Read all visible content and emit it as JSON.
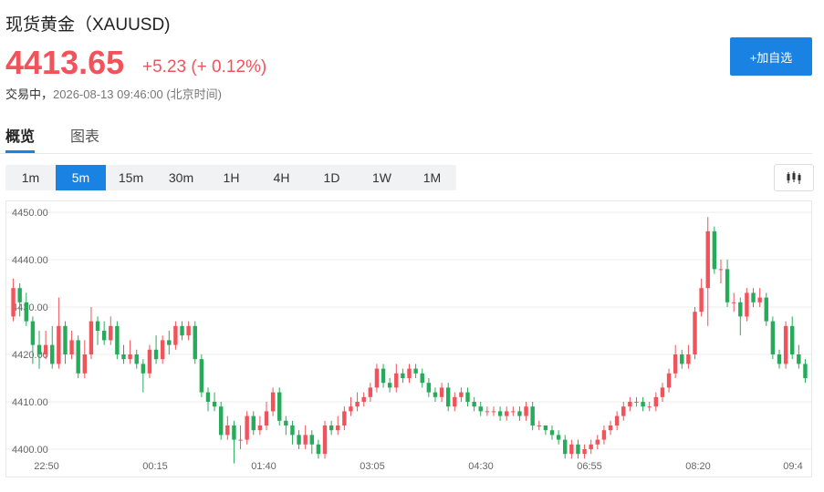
{
  "header": {
    "title": "现货黄金（XAUUSD)",
    "price": "4413.65",
    "change": "+5.23 (+ 0.12%)",
    "status_label": "交易中，",
    "timestamp": "2026-08-13 09:46:00 (北京时间)",
    "add_button": "+加自选"
  },
  "tabs": [
    {
      "label": "概览",
      "active": true
    },
    {
      "label": "图表",
      "active": false
    }
  ],
  "intervals": [
    {
      "label": "1m",
      "active": false
    },
    {
      "label": "5m",
      "active": true
    },
    {
      "label": "15m",
      "active": false
    },
    {
      "label": "30m",
      "active": false
    },
    {
      "label": "1H",
      "active": false
    },
    {
      "label": "4H",
      "active": false
    },
    {
      "label": "1D",
      "active": false
    },
    {
      "label": "1W",
      "active": false
    },
    {
      "label": "1M",
      "active": false
    }
  ],
  "chart_type_icon": "candlestick-icon",
  "colors": {
    "up": "#f0535a",
    "down": "#26ab5a",
    "accent": "#1a82e2"
  },
  "chart_data": {
    "type": "candlestick",
    "ylim": [
      4398,
      4452
    ],
    "yticks": [
      "4450.00",
      "4440.00",
      "4430.00",
      "4420.00",
      "4410.00",
      "4400.00"
    ],
    "xticks": [
      "22:50",
      "00:15",
      "01:40",
      "03:05",
      "04:30",
      "06:55",
      "08:20",
      "09:4"
    ],
    "grid": true,
    "candles": [
      [
        4428,
        4434,
        4436,
        4427
      ],
      [
        4434,
        4431,
        4435,
        4428
      ],
      [
        4431,
        4427,
        4433,
        4426
      ],
      [
        4427,
        4422,
        4428,
        4418
      ],
      [
        4422,
        4420,
        4425,
        4417
      ],
      [
        4420,
        4422,
        4425,
        4419
      ],
      [
        4422,
        4418,
        4426,
        4417
      ],
      [
        4418,
        4426,
        4432,
        4417
      ],
      [
        4426,
        4420,
        4427,
        4418
      ],
      [
        4420,
        4423,
        4425,
        4419
      ],
      [
        4423,
        4416,
        4424,
        4415
      ],
      [
        4416,
        4420,
        4423,
        4415
      ],
      [
        4420,
        4427,
        4430,
        4419
      ],
      [
        4427,
        4425,
        4428,
        4422
      ],
      [
        4425,
        4423,
        4427,
        4422
      ],
      [
        4423,
        4426,
        4428,
        4422
      ],
      [
        4426,
        4420,
        4427,
        4419
      ],
      [
        4420,
        4419,
        4422,
        4418
      ],
      [
        4419,
        4420,
        4423,
        4418
      ],
      [
        4420,
        4418,
        4421,
        4417
      ],
      [
        4418,
        4416,
        4419,
        4412
      ],
      [
        4416,
        4421,
        4422,
        4415
      ],
      [
        4421,
        4419,
        4424,
        4418
      ],
      [
        4419,
        4423,
        4424,
        4418
      ],
      [
        4423,
        4422,
        4425,
        4420
      ],
      [
        4422,
        4426,
        4427,
        4421
      ],
      [
        4426,
        4424,
        4427,
        4423
      ],
      [
        4424,
        4426,
        4427,
        4423
      ],
      [
        4426,
        4419,
        4427,
        4418
      ],
      [
        4419,
        4412,
        4420,
        4411
      ],
      [
        4412,
        4410,
        4413,
        4408
      ],
      [
        4410,
        4409,
        4412,
        4408
      ],
      [
        4409,
        4403,
        4410,
        4402
      ],
      [
        4403,
        4405,
        4407,
        4402
      ],
      [
        4405,
        4402,
        4406,
        4397
      ],
      [
        4402,
        4402,
        4405,
        4400
      ],
      [
        4402,
        4407,
        4408,
        4401
      ],
      [
        4407,
        4404,
        4408,
        4403
      ],
      [
        4404,
        4405,
        4407,
        4403
      ],
      [
        4405,
        4408,
        4410,
        4404
      ],
      [
        4408,
        4412,
        4413,
        4407
      ],
      [
        4412,
        4406,
        4413,
        4405
      ],
      [
        4406,
        4405,
        4407,
        4403
      ],
      [
        4405,
        4403,
        4406,
        4401
      ],
      [
        4403,
        4401,
        4404,
        4400
      ],
      [
        4401,
        4403,
        4405,
        4400
      ],
      [
        4403,
        4401,
        4404,
        4399
      ],
      [
        4401,
        4399,
        4402,
        4398
      ],
      [
        4399,
        4405,
        4406,
        4398
      ],
      [
        4405,
        4404,
        4406,
        4403
      ],
      [
        4404,
        4405,
        4407,
        4403
      ],
      [
        4405,
        4408,
        4409,
        4404
      ],
      [
        4408,
        4409,
        4411,
        4407
      ],
      [
        4409,
        4410,
        4412,
        4408
      ],
      [
        4410,
        4411,
        4412,
        4409
      ],
      [
        4411,
        4413,
        4414,
        4410
      ],
      [
        4413,
        4417,
        4418,
        4412
      ],
      [
        4417,
        4414,
        4418,
        4413
      ],
      [
        4414,
        4413,
        4415,
        4412
      ],
      [
        4413,
        4416,
        4418,
        4412
      ],
      [
        4416,
        4415,
        4417,
        4414
      ],
      [
        4415,
        4417,
        4418,
        4414
      ],
      [
        4417,
        4416,
        4418,
        4415
      ],
      [
        4416,
        4414,
        4417,
        4413
      ],
      [
        4414,
        4412,
        4415,
        4411
      ],
      [
        4412,
        4411,
        4413,
        4410
      ],
      [
        4411,
        4413,
        4414,
        4410
      ],
      [
        4413,
        4409,
        4414,
        4408
      ],
      [
        4409,
        4411,
        4412,
        4408
      ],
      [
        4411,
        4412,
        4413,
        4410
      ],
      [
        4412,
        4410,
        4413,
        4409
      ],
      [
        4410,
        4409,
        4411,
        4408
      ],
      [
        4409,
        4408,
        4410,
        4407
      ],
      [
        4408,
        4408,
        4409,
        4407
      ],
      [
        4408,
        4408,
        4409,
        4407
      ],
      [
        4408,
        4407,
        4409,
        4406
      ],
      [
        4407,
        4408,
        4409,
        4406
      ],
      [
        4408,
        4408,
        4409,
        4407
      ],
      [
        4408,
        4407,
        4409,
        4406
      ],
      [
        4407,
        4409,
        4410,
        4406
      ],
      [
        4409,
        4405,
        4410,
        4404
      ],
      [
        4405,
        4405,
        4406,
        4404
      ],
      [
        4405,
        4404,
        4405,
        4403
      ],
      [
        4404,
        4403,
        4405,
        4402
      ],
      [
        4403,
        4402,
        4404,
        4401
      ],
      [
        4402,
        4399,
        4403,
        4398
      ],
      [
        4399,
        4401,
        4402,
        4398
      ],
      [
        4401,
        4399,
        4402,
        4398
      ],
      [
        4399,
        4400,
        4401,
        4398
      ],
      [
        4400,
        4401,
        4402,
        4399
      ],
      [
        4401,
        4402,
        4403,
        4400
      ],
      [
        4402,
        4404,
        4405,
        4401
      ],
      [
        4404,
        4405,
        4406,
        4403
      ],
      [
        4405,
        4407,
        4408,
        4404
      ],
      [
        4407,
        4409,
        4410,
        4406
      ],
      [
        4409,
        4410,
        4411,
        4408
      ],
      [
        4410,
        4410,
        4411,
        4409
      ],
      [
        4410,
        4409,
        4411,
        4408
      ],
      [
        4409,
        4409,
        4410,
        4408
      ],
      [
        4409,
        4411,
        4412,
        4408
      ],
      [
        4411,
        4413,
        4414,
        4410
      ],
      [
        4413,
        4416,
        4417,
        4412
      ],
      [
        4416,
        4420,
        4422,
        4415
      ],
      [
        4420,
        4418,
        4421,
        4417
      ],
      [
        4418,
        4420,
        4422,
        4417
      ],
      [
        4420,
        4429,
        4430,
        4419
      ],
      [
        4429,
        4434,
        4436,
        4428
      ],
      [
        4434,
        4446,
        4449,
        4426
      ],
      [
        4446,
        4438,
        4447,
        4437
      ],
      [
        4438,
        4438,
        4440,
        4435
      ],
      [
        4438,
        4431,
        4440,
        4430
      ],
      [
        4431,
        4431,
        4433,
        4429
      ],
      [
        4431,
        4428,
        4432,
        4424
      ],
      [
        4428,
        4433,
        4434,
        4427
      ],
      [
        4433,
        4431,
        4434,
        4430
      ],
      [
        4431,
        4432,
        4434,
        4430
      ],
      [
        4432,
        4427,
        4433,
        4426
      ],
      [
        4427,
        4420,
        4428,
        4419
      ],
      [
        4420,
        4418,
        4421,
        4417
      ],
      [
        4418,
        4426,
        4427,
        4417
      ],
      [
        4426,
        4420,
        4428,
        4419
      ],
      [
        4420,
        4418,
        4422,
        4417
      ],
      [
        4418,
        4415,
        4419,
        4414
      ]
    ]
  }
}
